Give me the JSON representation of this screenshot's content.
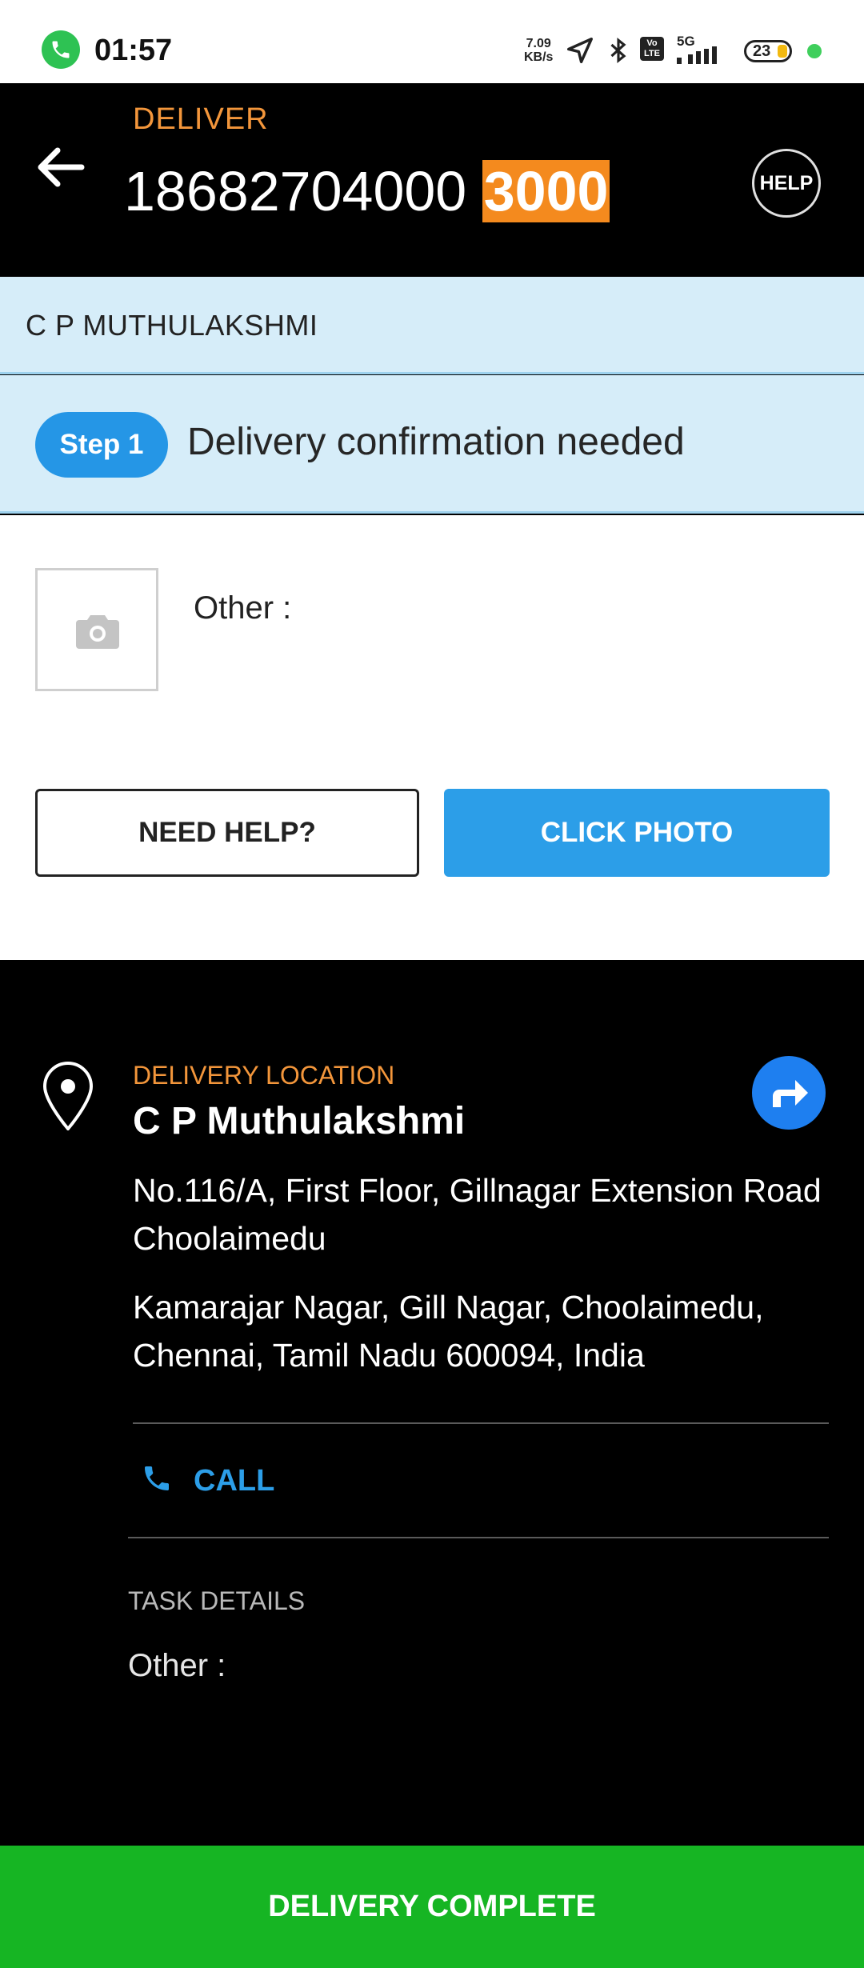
{
  "status_bar": {
    "time": "01:57",
    "net_speed_value": "7.09",
    "net_speed_unit": "KB/s",
    "network": "5G",
    "battery": "23",
    "icons": [
      "phone-call-icon",
      "location-arrow-icon",
      "bluetooth-icon",
      "volte-icon",
      "signal-icon",
      "battery-icon"
    ]
  },
  "header": {
    "section_label": "DELIVER",
    "order_number": "18682704000",
    "order_suffix": "3000",
    "help_label": "HELP"
  },
  "customer": {
    "name": "C P MUTHULAKSHMI"
  },
  "step": {
    "pill": "Step 1",
    "text": "Delivery confirmation needed"
  },
  "photo_section": {
    "other_label": "Other :",
    "need_help_label": "NEED HELP?",
    "click_photo_label": "CLICK PHOTO"
  },
  "location": {
    "label": "DELIVERY LOCATION",
    "name": "C P Muthulakshmi",
    "address_line1": "No.116/A, First Floor, Gillnagar Extension Road Choolaimedu",
    "address_line2": "Kamarajar Nagar, Gill Nagar, Choolaimedu, Chennai, Tamil Nadu 600094, India",
    "call_label": "CALL"
  },
  "task": {
    "label": "TASK DETAILS",
    "other": "Other :"
  },
  "footer": {
    "complete_label": "DELIVERY COMPLETE"
  },
  "colors": {
    "accent_orange": "#f3963b",
    "highlight_orange": "#f48a1e",
    "blue": "#2c9ee8",
    "green": "#16b523",
    "band_bg": "#d6edf9"
  }
}
